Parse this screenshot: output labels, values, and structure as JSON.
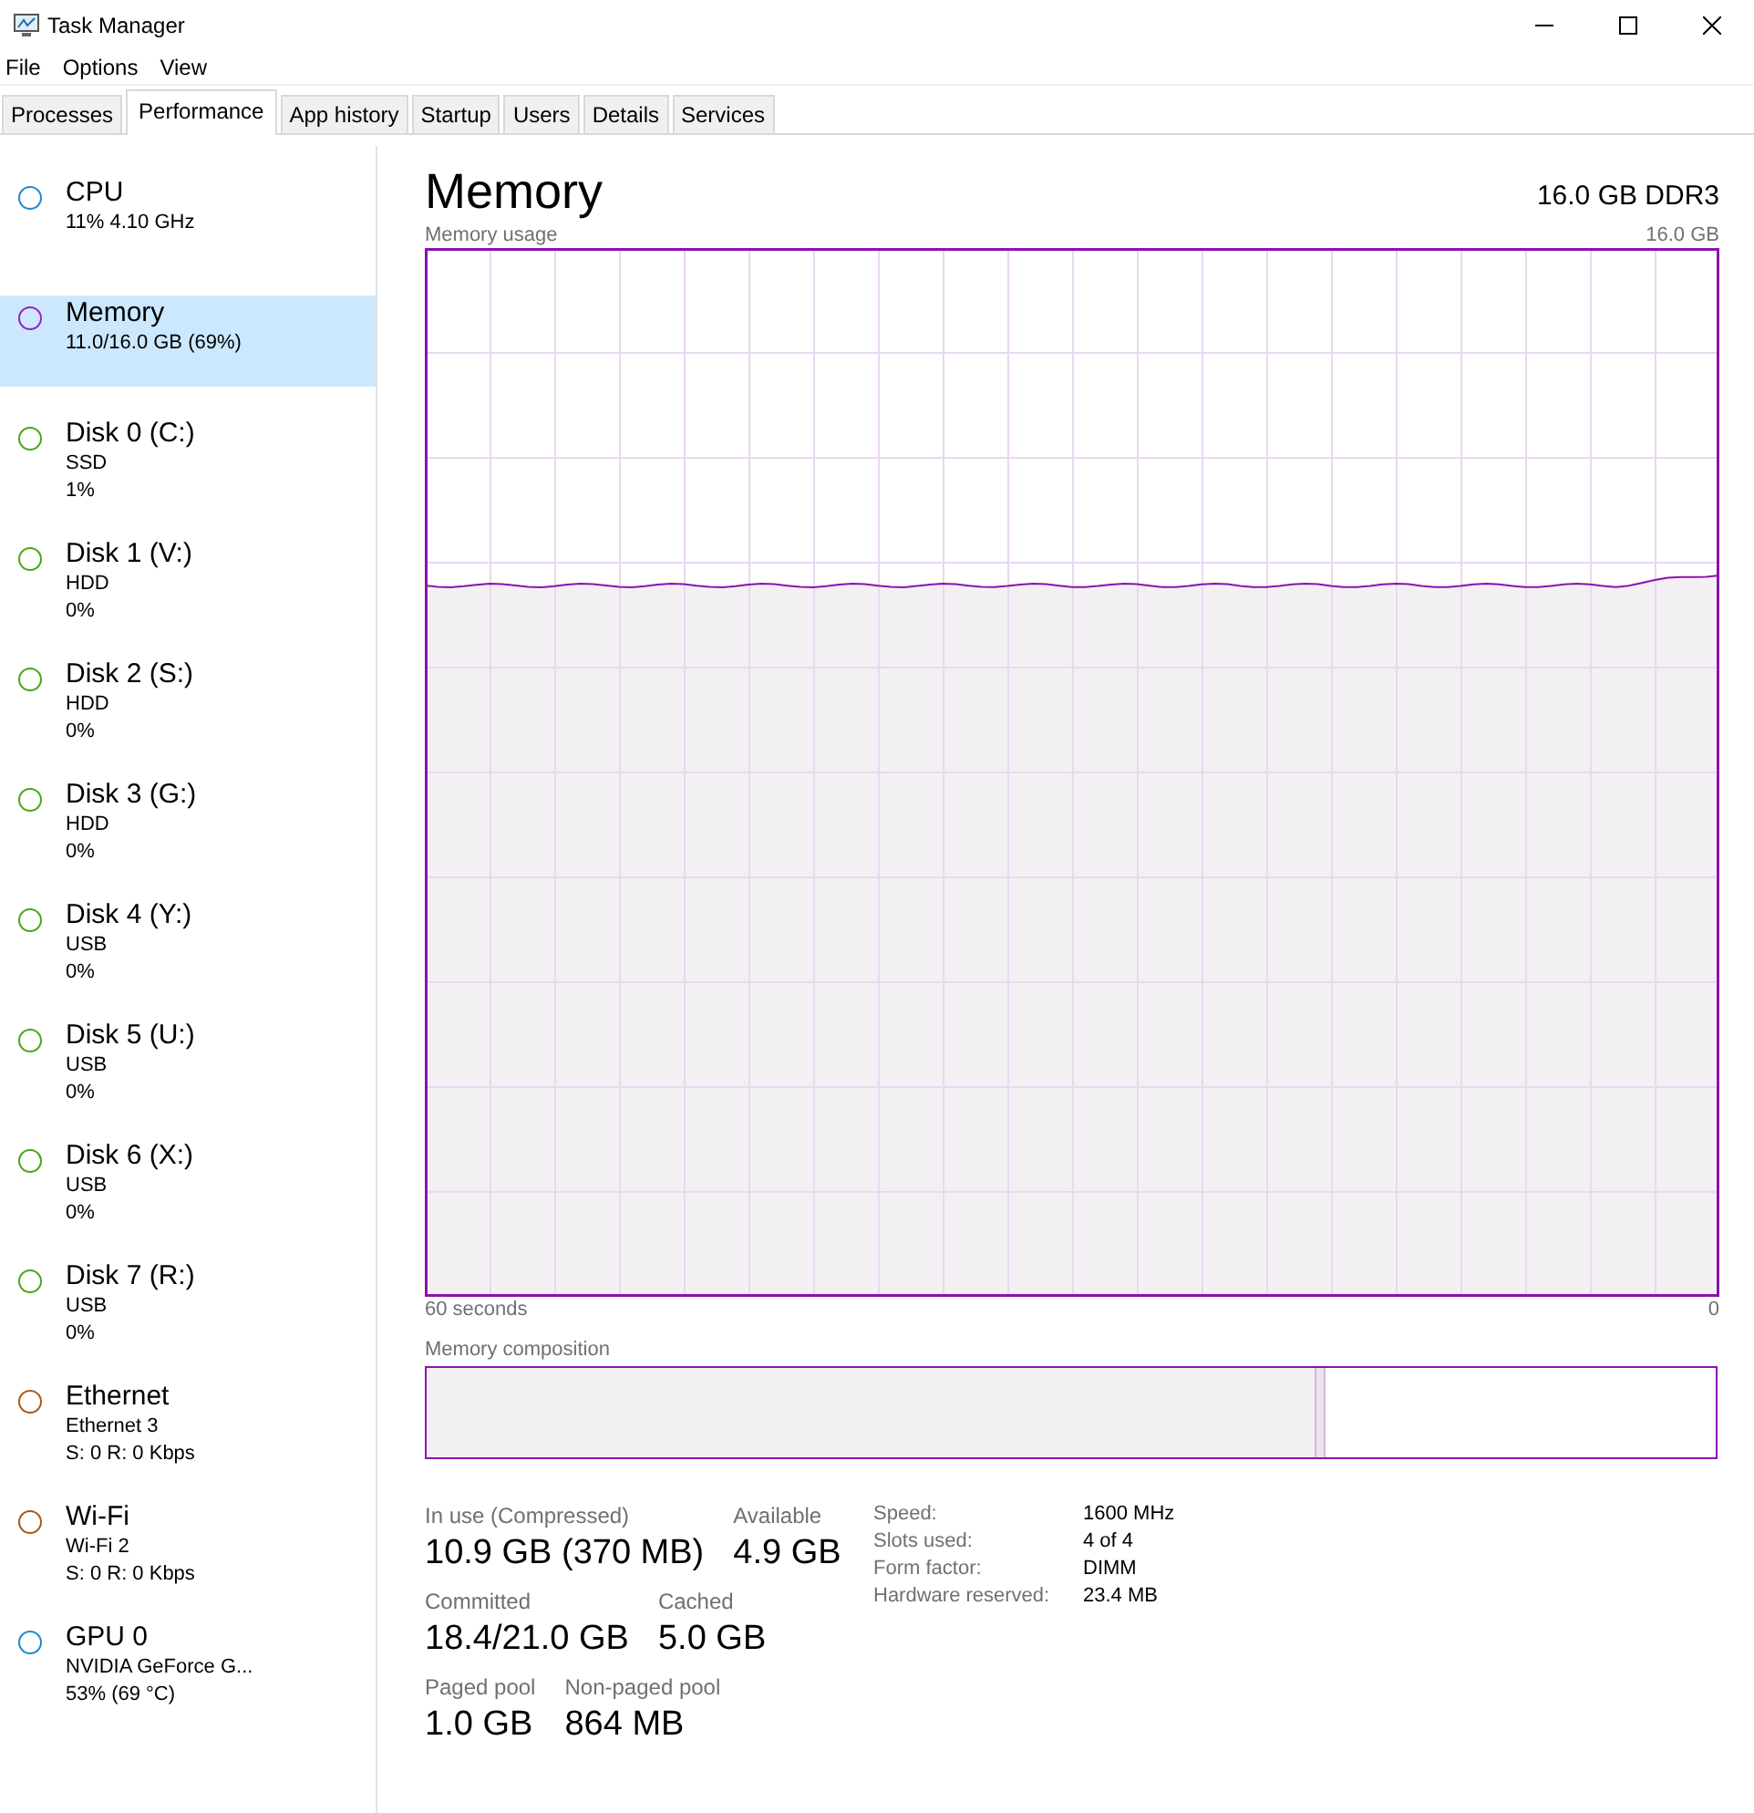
{
  "window": {
    "title": "Task Manager"
  },
  "menu": [
    "File",
    "Options",
    "View"
  ],
  "tabs": [
    {
      "label": "Processes",
      "selected": false
    },
    {
      "label": "Performance",
      "selected": true
    },
    {
      "label": "App history",
      "selected": false
    },
    {
      "label": "Startup",
      "selected": false
    },
    {
      "label": "Users",
      "selected": false
    },
    {
      "label": "Details",
      "selected": false
    },
    {
      "label": "Services",
      "selected": false
    }
  ],
  "sidebar": {
    "items": [
      {
        "name": "CPU",
        "lines": [
          "11%  4.10 GHz"
        ],
        "color": "#1c8bd0",
        "selected": false
      },
      {
        "name": "Memory",
        "lines": [
          "11.0/16.0 GB (69%)"
        ],
        "color": "#9b1fc0",
        "selected": true
      },
      {
        "name": "Disk 0 (C:)",
        "lines": [
          "SSD",
          "1%"
        ],
        "color": "#4ea514",
        "selected": false
      },
      {
        "name": "Disk 1 (V:)",
        "lines": [
          "HDD",
          "0%"
        ],
        "color": "#4ea514",
        "selected": false
      },
      {
        "name": "Disk 2 (S:)",
        "lines": [
          "HDD",
          "0%"
        ],
        "color": "#4ea514",
        "selected": false
      },
      {
        "name": "Disk 3 (G:)",
        "lines": [
          "HDD",
          "0%"
        ],
        "color": "#4ea514",
        "selected": false
      },
      {
        "name": "Disk 4 (Y:)",
        "lines": [
          "USB",
          "0%"
        ],
        "color": "#4ea514",
        "selected": false
      },
      {
        "name": "Disk 5 (U:)",
        "lines": [
          "USB",
          "0%"
        ],
        "color": "#4ea514",
        "selected": false
      },
      {
        "name": "Disk 6 (X:)",
        "lines": [
          "USB",
          "0%"
        ],
        "color": "#4ea514",
        "selected": false
      },
      {
        "name": "Disk 7 (R:)",
        "lines": [
          "USB",
          "0%"
        ],
        "color": "#4ea514",
        "selected": false
      },
      {
        "name": "Ethernet",
        "lines": [
          "Ethernet 3",
          "S: 0 R: 0 Kbps"
        ],
        "color": "#a85a1a",
        "selected": false
      },
      {
        "name": "Wi-Fi",
        "lines": [
          "Wi-Fi 2",
          "S: 0 R: 0 Kbps"
        ],
        "color": "#a85a1a",
        "selected": false
      },
      {
        "name": "GPU 0",
        "lines": [
          "NVIDIA GeForce G...",
          "53%  (69 °C)"
        ],
        "color": "#1c8bd0",
        "selected": false
      }
    ]
  },
  "main": {
    "title": "Memory",
    "subtitle": "16.0 GB DDR3",
    "usage_graph": {
      "label": "Memory usage",
      "max_label": "16.0 GB",
      "left_label": "60 seconds",
      "right_label": "0"
    },
    "composition": {
      "label": "Memory composition",
      "segments": [
        {
          "kind": "in_use",
          "level": 0.689
        },
        {
          "kind": "modified",
          "level": 0.006
        }
      ]
    },
    "stats": [
      {
        "label": "In use (Compressed)",
        "value": "10.9 GB (370 MB)"
      },
      {
        "label": "Available",
        "value": "4.9 GB"
      },
      {
        "label": "Committed",
        "value": "18.4/21.0 GB"
      },
      {
        "label": "Cached",
        "value": "5.0 GB"
      },
      {
        "label": "Paged pool",
        "value": "1.0 GB"
      },
      {
        "label": "Non-paged pool",
        "value": "864 MB"
      }
    ],
    "details": [
      {
        "label": "Speed:",
        "value": "1600 MHz"
      },
      {
        "label": "Slots used:",
        "value": "4 of 4"
      },
      {
        "label": "Form factor:",
        "value": "DIMM"
      },
      {
        "label": "Hardware reserved:",
        "value": "23.4 MB"
      }
    ]
  }
}
